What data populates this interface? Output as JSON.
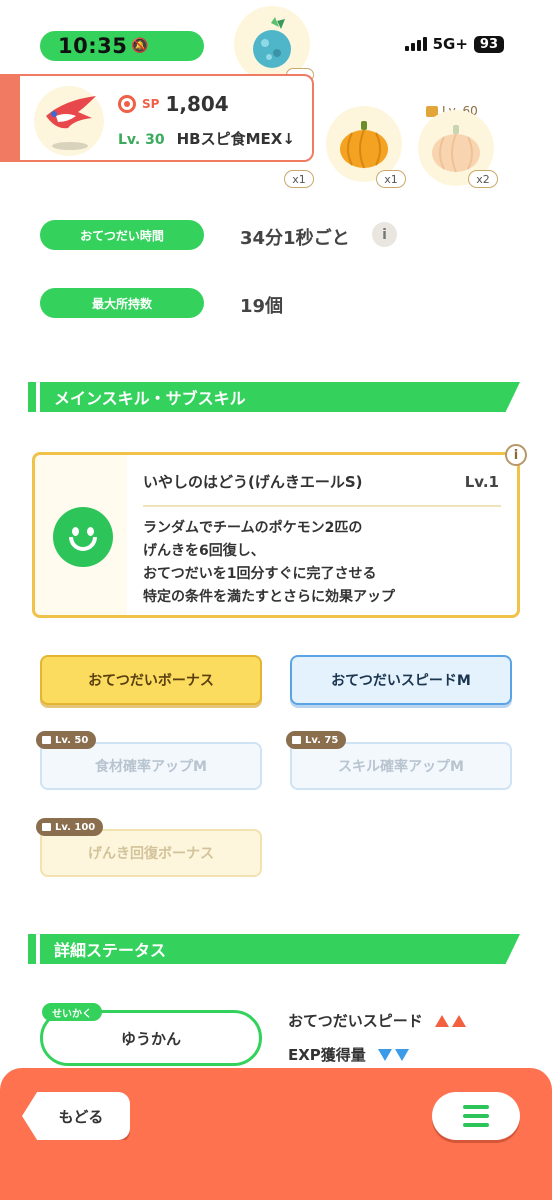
{
  "status_bar": {
    "time": "10:35",
    "network": "5G+",
    "battery": "93"
  },
  "ingredients": [
    {
      "name": "teal-gem-ingredient",
      "count": "",
      "color": "#4fb6c9"
    },
    {
      "name": "pumpkin-ingredient",
      "count": "x1",
      "color": "#f3a321"
    },
    {
      "name": "pumpkin-ingredient",
      "count": "x1",
      "color": "#f3a321"
    },
    {
      "name": "pumpkin-ingredient-locked",
      "count": "x2",
      "lock_level": "Lv. 60",
      "color": "#f8d5b0"
    }
  ],
  "pokemon": {
    "sp_label": "SP",
    "sp_value": "1,804",
    "level": "Lv. 30",
    "nickname": "HBスピ食MEX↓"
  },
  "info": {
    "help_time_label": "おてつだい時間",
    "help_time_value": "34分1秒ごと",
    "max_carry_label": "最大所持数",
    "max_carry_value": "19個"
  },
  "skill_section": {
    "title": "メインスキル・サブスキル",
    "main_skill": {
      "name": "いやしのはどう(げんきエールS)",
      "level": "Lv.1",
      "description": [
        "ランダムでチームのポケモン2匹の",
        "げんきを6回復し、",
        "おてつだいを1回分すぐに完了させる",
        "特定の条件を満たすとさらに効果アップ"
      ]
    },
    "sub_skills": [
      {
        "label": "おてつだいボーナス",
        "unlocked": true
      },
      {
        "label": "おてつだいスピードM",
        "unlocked": true
      },
      {
        "label": "食材確率アップM",
        "unlocked": false,
        "lock_level": "Lv. 50"
      },
      {
        "label": "スキル確率アップM",
        "unlocked": false,
        "lock_level": "Lv. 75"
      },
      {
        "label": "げんき回復ボーナス",
        "unlocked": false,
        "lock_level": "Lv. 100"
      }
    ]
  },
  "detail_section": {
    "title": "詳細ステータス",
    "nature_tag": "せいかく",
    "nature": "ゆうかん",
    "effects": [
      {
        "label": "おてつだいスピード",
        "direction": "up"
      },
      {
        "label": "EXP獲得量",
        "direction": "down"
      }
    ]
  },
  "bottom_bar": {
    "back_label": "もどる"
  },
  "colors": {
    "accent_green": "#34d25c",
    "accent_orange": "#ff7250",
    "gold": "#fbdc5e"
  }
}
